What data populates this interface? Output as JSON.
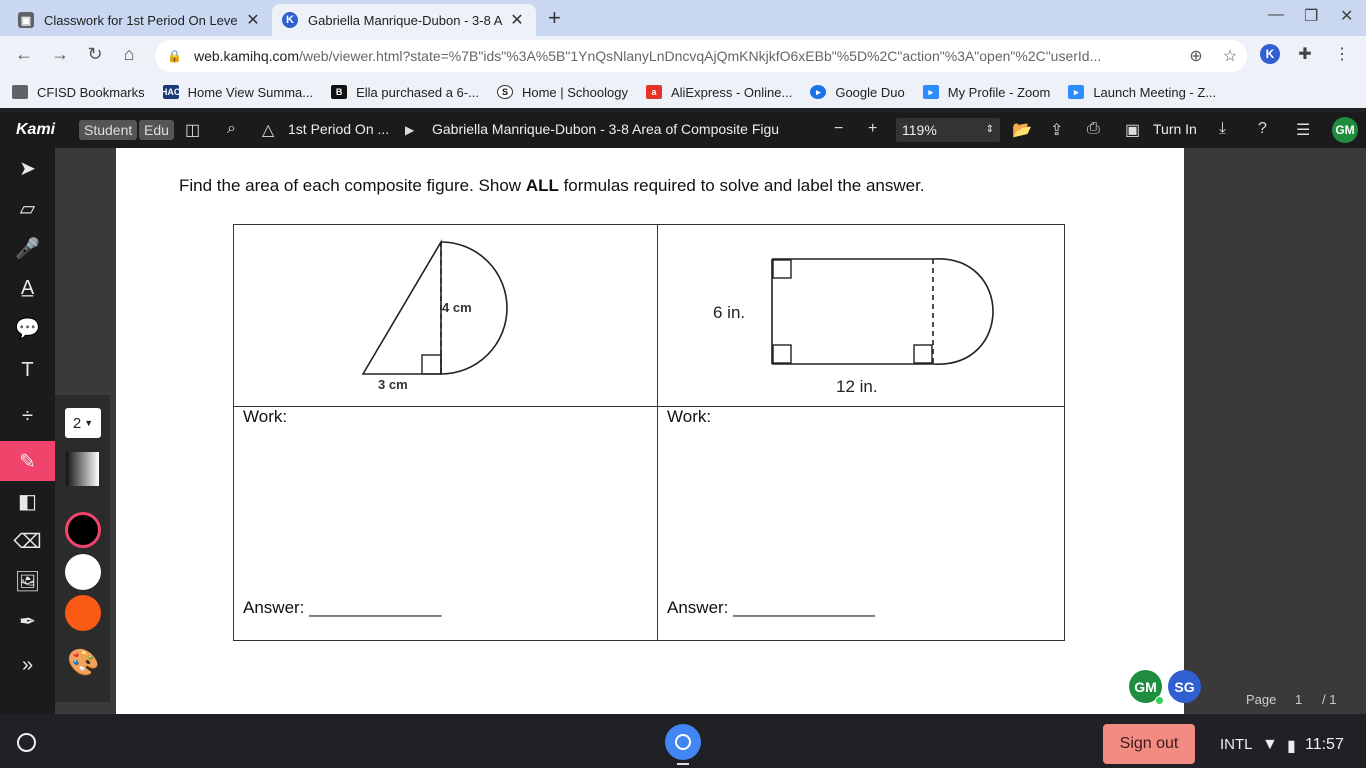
{
  "browser": {
    "tabs": [
      {
        "title": "Classwork for 1st Period On Leve",
        "active": false
      },
      {
        "title": "Gabriella Manrique-Dubon - 3-8 A",
        "active": true
      }
    ],
    "url_main": "web.kamihq.com",
    "url_rest": "/web/viewer.html?state=%7B\"ids\"%3A%5B\"1YnQsNlanyLnDncvqAjQmKNkjkfO6xEBb\"%5D%2C\"action\"%3A\"open\"%2C\"userId...",
    "profile_initial": "K"
  },
  "bookmarks": [
    {
      "label": "CFISD Bookmarks",
      "icon": "folder-icon"
    },
    {
      "label": "Home View Summa...",
      "icon": "hac-icon"
    },
    {
      "label": "Ella purchased a 6-...",
      "icon": "b-icon"
    },
    {
      "label": "Home | Schoology",
      "icon": "schoology-icon"
    },
    {
      "label": "AliExpress - Online...",
      "icon": "aliexpress-icon"
    },
    {
      "label": "Google Duo",
      "icon": "duo-icon"
    },
    {
      "label": "My Profile - Zoom",
      "icon": "zoom-icon"
    },
    {
      "label": "Launch Meeting - Z...",
      "icon": "zoom-icon"
    }
  ],
  "kami": {
    "logo": "Kami",
    "roles": [
      "Student",
      "Edu"
    ],
    "folder": "1st Period On ...",
    "doc_title": "Gabriella Manrique-Dubon - 3-8 Area of Composite Figu",
    "zoom": "119%",
    "turn_in": "Turn In",
    "user_initials": "GM",
    "stroke_size": "2"
  },
  "document": {
    "instruction_pre": "Find the area of each composite figure. Show ",
    "instruction_bold": "ALL",
    "instruction_post": " formulas required to solve and label the answer.",
    "fig1": {
      "height_label": "4 cm",
      "base_label": "3 cm"
    },
    "fig2": {
      "height_label": "6 in.",
      "length_label": "12 in."
    },
    "work_label": "Work:",
    "answer_label": "Answer: ",
    "answer_line_1": "______________",
    "answer_line_2": "_______________"
  },
  "collaborators": [
    {
      "initials": "GM",
      "color": "#1e8e3e"
    },
    {
      "initials": "SG",
      "color": "#2f5fd0"
    }
  ],
  "pager": {
    "label": "Page",
    "current": "1",
    "total": "/ 1"
  },
  "shelf": {
    "sign_out": "Sign out",
    "ime": "INTL",
    "time": "11:57"
  }
}
